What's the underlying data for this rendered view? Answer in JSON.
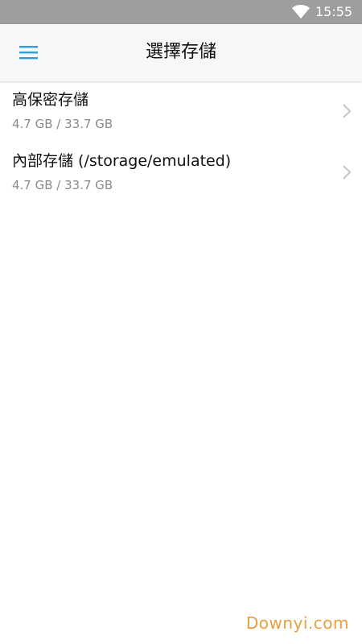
{
  "status_bar": {
    "time": "15:55",
    "wifi_icon": "wifi-icon",
    "background": "#9e9e9e"
  },
  "app_bar": {
    "title": "選擇存儲",
    "menu_icon": "hamburger-menu-icon",
    "accent": "#2f9fd6"
  },
  "storage": {
    "items": [
      {
        "name": "高保密存儲",
        "size": "4.7 GB / 33.7 GB",
        "icon": "chevron-right-icon"
      },
      {
        "name": "內部存儲 (/storage/emulated)",
        "size": "4.7 GB / 33.7 GB",
        "icon": "chevron-right-icon"
      }
    ]
  },
  "watermark": {
    "text": "Downyi.com",
    "color": "#e8a03c"
  }
}
